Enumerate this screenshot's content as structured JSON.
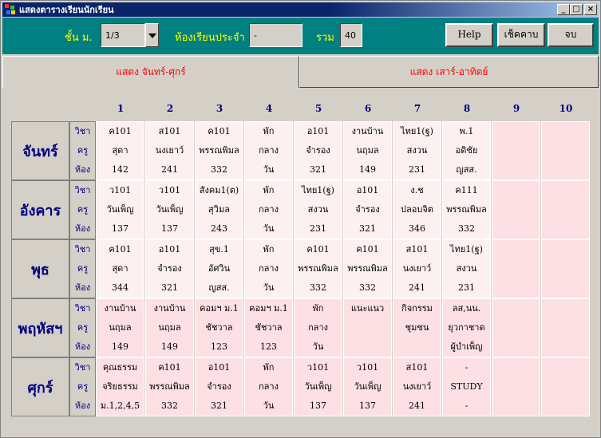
{
  "window": {
    "title": "แสดงตารางเรียนนักเรียน"
  },
  "header": {
    "grade_label": "ชั้น ม.",
    "grade_value": "1/3",
    "advisor_label": "ห้องเรียนประจำ",
    "advisor_value": "-",
    "total_label": "รวม",
    "total_value": "40",
    "help_label": "Help",
    "check_label": "เช็คคาบ",
    "close_label": "จบ"
  },
  "tabs": [
    {
      "label": "แสดง จันทร์-ศุกร์",
      "active": true
    },
    {
      "label": "แสดง เสาร์-อาทิตย์",
      "active": false
    }
  ],
  "periods": [
    "1",
    "2",
    "3",
    "4",
    "5",
    "6",
    "7",
    "8",
    "9",
    "10"
  ],
  "row_keys": [
    "วิชา",
    "ครู",
    "ห้อง"
  ],
  "days": [
    {
      "name": "จันทร์",
      "cells": [
        [
          "ค101",
          "สุดา",
          "142"
        ],
        [
          "ส101",
          "นงเยาว์",
          "241"
        ],
        [
          "ค101",
          "พรรณพิมล",
          "332"
        ],
        [
          "พัก",
          "กลาง",
          "วัน"
        ],
        [
          "อ101",
          "จำรอง",
          "321"
        ],
        [
          "งานบ้าน",
          "นฤมล",
          "149"
        ],
        [
          "ไทย1(ฐ)",
          "สงวน",
          "231"
        ],
        [
          "พ.1",
          "อดิชัย",
          "ญสส."
        ],
        [
          "",
          "",
          ""
        ],
        [
          "",
          "",
          ""
        ]
      ]
    },
    {
      "name": "อังคาร",
      "cells": [
        [
          "ว101",
          "วันเพ็ญ",
          "137"
        ],
        [
          "ว101",
          "วันเพ็ญ",
          "137"
        ],
        [
          "สังคม1(ต)",
          "สุวิมล",
          "243"
        ],
        [
          "พัก",
          "กลาง",
          "วัน"
        ],
        [
          "ไทย1(ฐ)",
          "สงวน",
          "231"
        ],
        [
          "อ101",
          "จำรอง",
          "321"
        ],
        [
          "ง.ช",
          "ปลอบจิต",
          "346"
        ],
        [
          "ค111",
          "พรรณพิมล",
          "332"
        ],
        [
          "",
          "",
          ""
        ],
        [
          "",
          "",
          ""
        ]
      ]
    },
    {
      "name": "พุธ",
      "cells": [
        [
          "ค101",
          "สุดา",
          "344"
        ],
        [
          "อ101",
          "จำรอง",
          "321"
        ],
        [
          "สุข.1",
          "อัศวิน",
          "ญสส."
        ],
        [
          "พัก",
          "กลาง",
          "วัน"
        ],
        [
          "ค101",
          "พรรณพิมล",
          "332"
        ],
        [
          "ค101",
          "พรรณพิมล",
          "332"
        ],
        [
          "ส101",
          "นงเยาว์",
          "241"
        ],
        [
          "ไทย1(ฐ)",
          "สงวน",
          "231"
        ],
        [
          "",
          "",
          ""
        ],
        [
          "",
          "",
          ""
        ]
      ]
    },
    {
      "name": "พฤหัสฯ",
      "cells": [
        [
          "งานบ้าน",
          "นฤมล",
          "149"
        ],
        [
          "งานบ้าน",
          "นฤมล",
          "149"
        ],
        [
          "คอมฯ ม.1",
          "ชัชวาล",
          "123"
        ],
        [
          "คอมฯ ม.1",
          "ชัชวาล",
          "123"
        ],
        [
          "พัก",
          "กลาง",
          "วัน"
        ],
        [
          "แนะแนว",
          "",
          ""
        ],
        [
          "กิจกรรม",
          "ชุมชน",
          ""
        ],
        [
          "ลส,นน.",
          "ยุวกาชาด",
          "ผู้บำเพ็ญ"
        ],
        [
          "",
          "",
          ""
        ],
        [
          "",
          "",
          ""
        ]
      ]
    },
    {
      "name": "ศุกร์",
      "cells": [
        [
          "คุณธรรม",
          "จริยธรรม",
          "ม.1,2,4,5"
        ],
        [
          "ค101",
          "พรรณพิมล",
          "332"
        ],
        [
          "อ101",
          "จำรอง",
          "321"
        ],
        [
          "พัก",
          "กลาง",
          "วัน"
        ],
        [
          "ว101",
          "วันเพ็ญ",
          "137"
        ],
        [
          "ว101",
          "วันเพ็ญ",
          "137"
        ],
        [
          "ส101",
          "นงเยาว์",
          "241"
        ],
        [
          "-",
          "STUDY",
          "-"
        ],
        [
          "",
          "",
          ""
        ],
        [
          "",
          "",
          ""
        ]
      ]
    }
  ],
  "colors": {
    "title_bar": "#0a246a",
    "header_bg": "#008080",
    "header_text": "#ffff00",
    "tab_text": "#ff0000",
    "label_text": "#000080",
    "cell_light": "#fdf0f0",
    "cell_pink": "#fce0e3"
  }
}
